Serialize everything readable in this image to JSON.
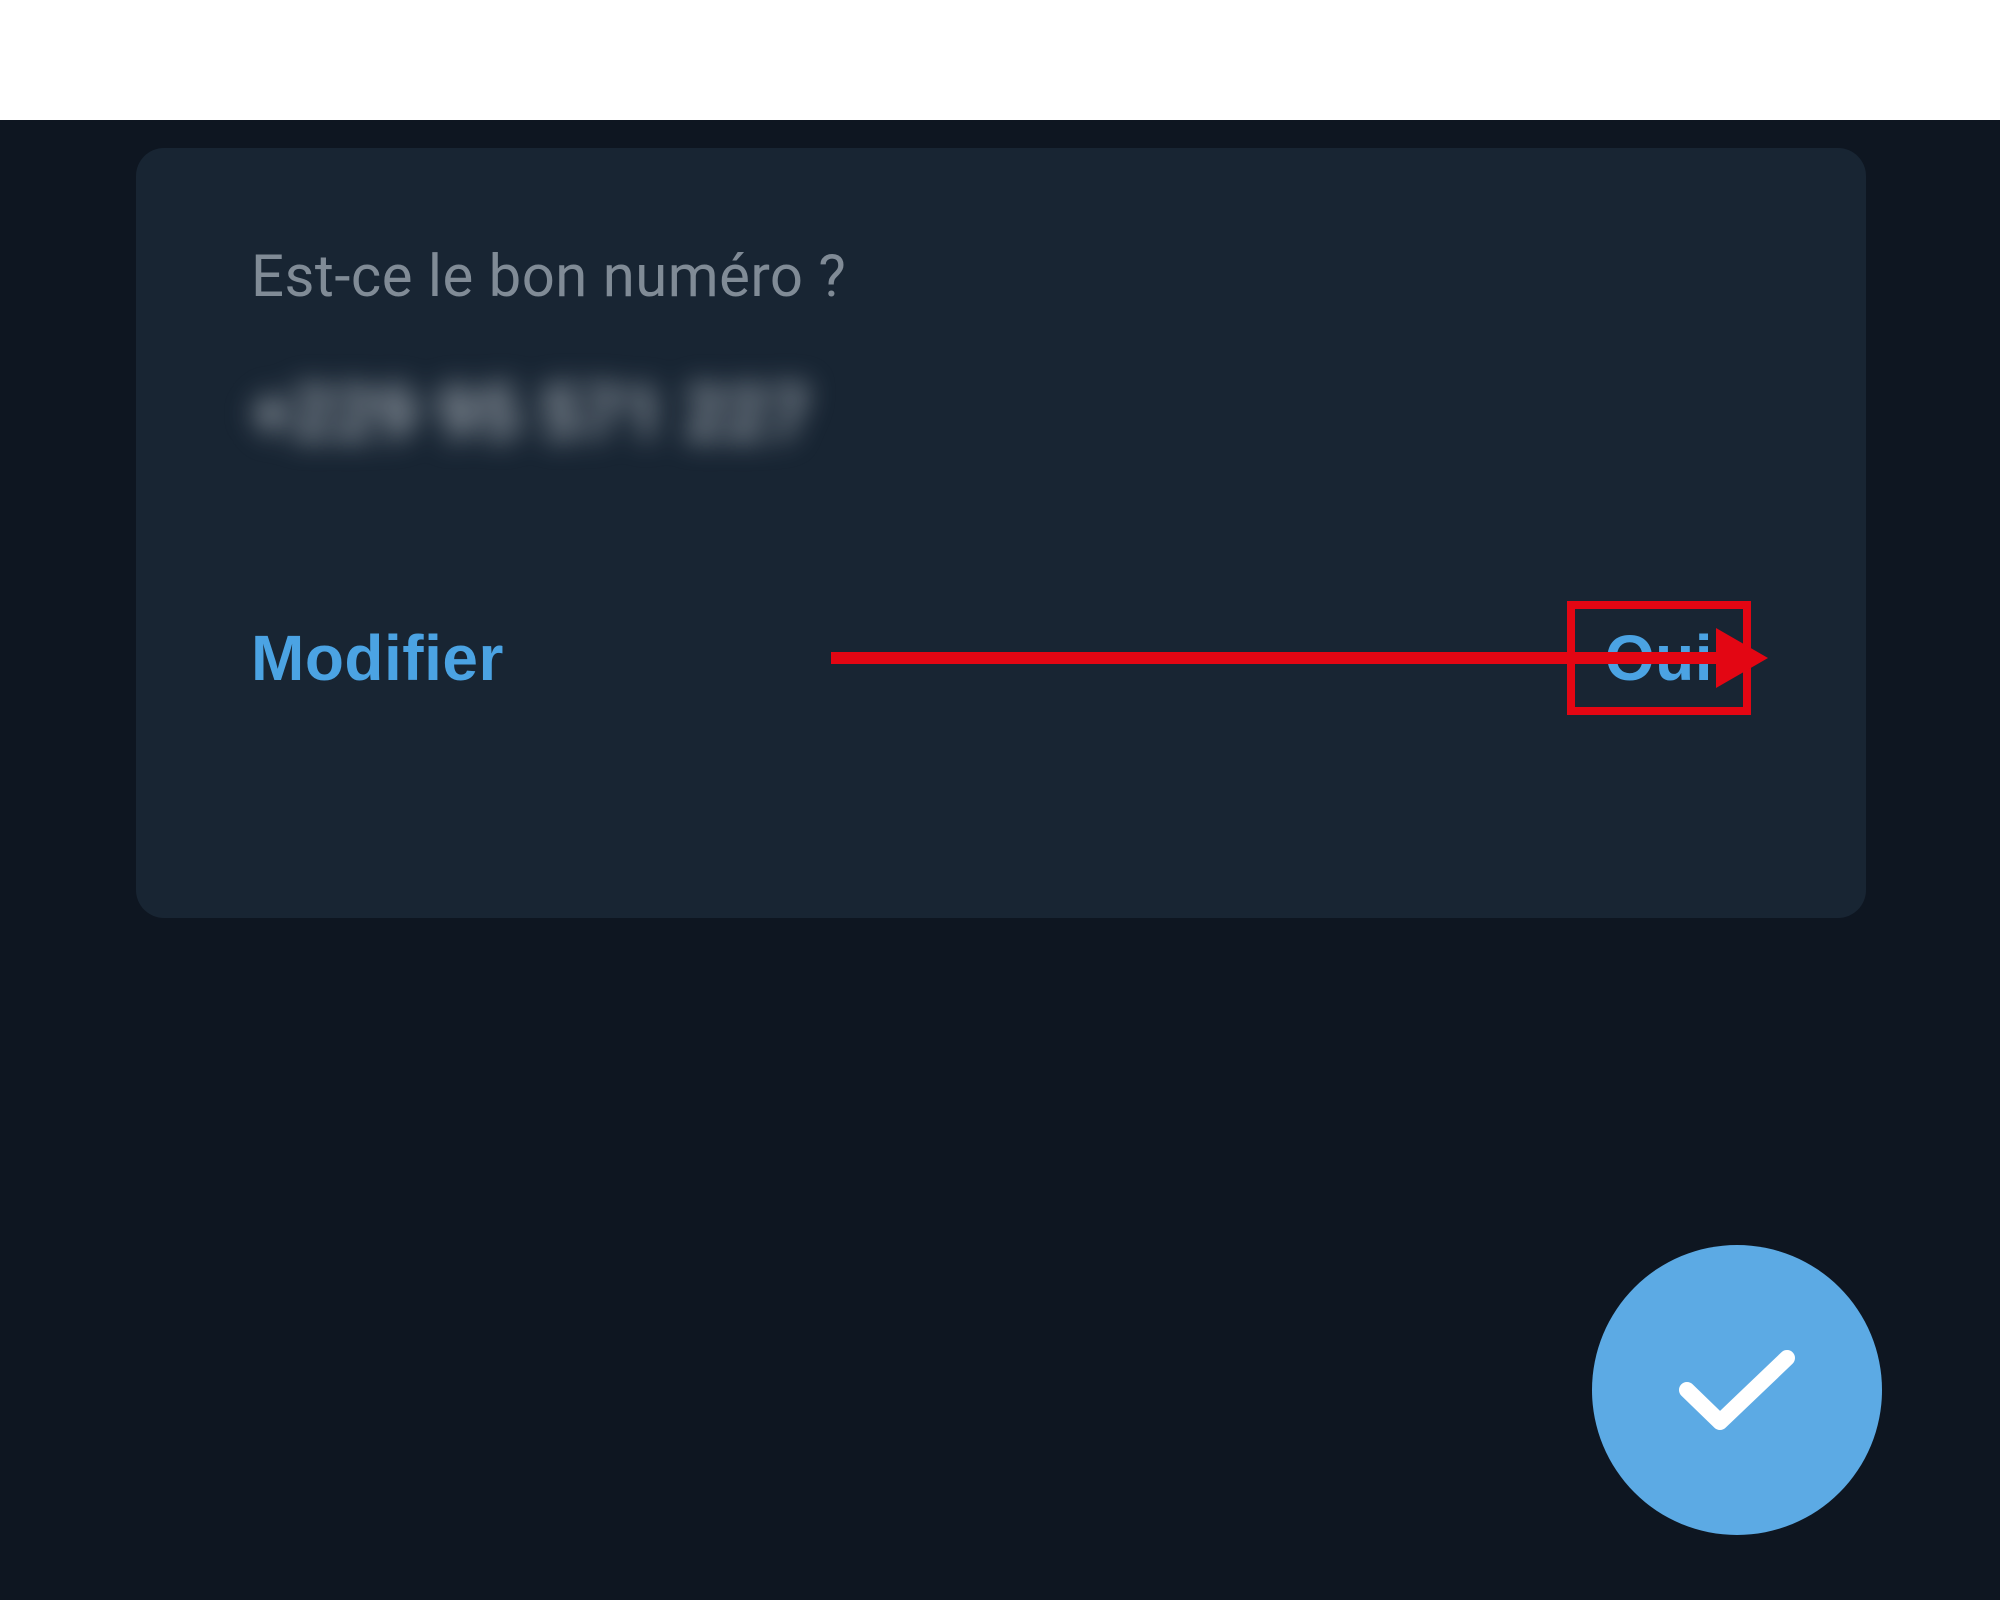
{
  "dialog": {
    "title": "Est-ce le bon numéro ?",
    "phone_number": "+229 95 571 227",
    "edit_label": "Modifier",
    "confirm_label": "Oui"
  },
  "colors": {
    "accent": "#4ba3e3",
    "highlight": "#e30613",
    "fab": "#5caae4",
    "card_bg": "#182533",
    "app_bg": "#0e1621"
  }
}
